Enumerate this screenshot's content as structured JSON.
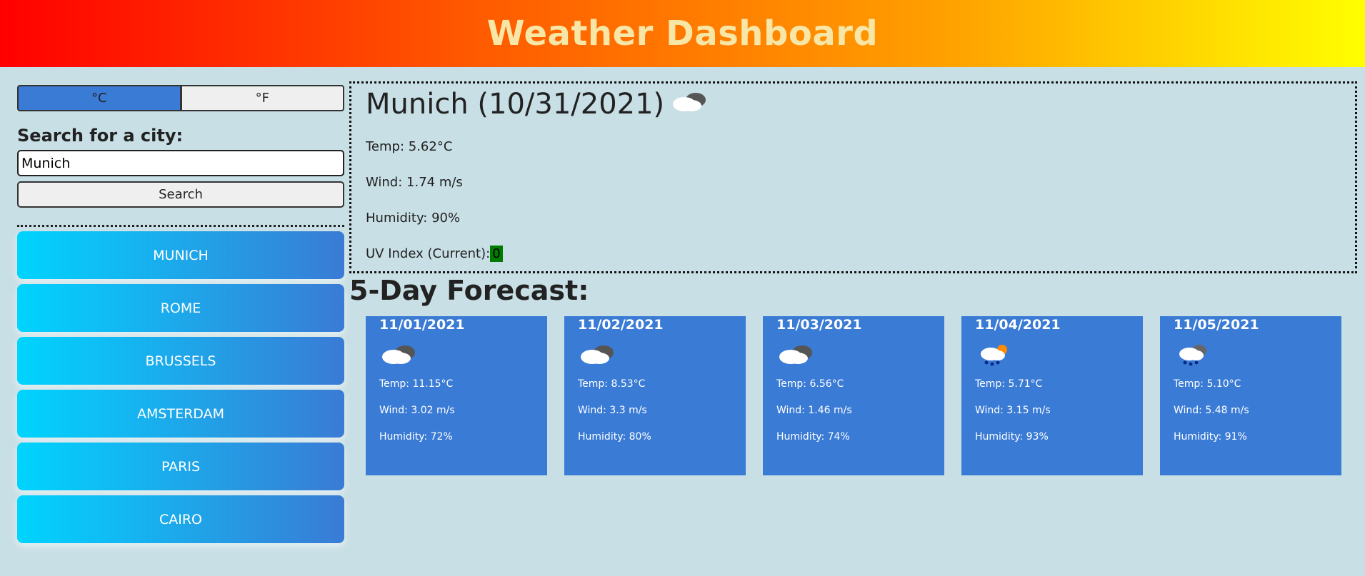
{
  "header": {
    "title": "Weather Dashboard"
  },
  "units": {
    "celsius_label": "°C",
    "fahrenheit_label": "°F",
    "active": "celsius"
  },
  "search": {
    "label": "Search for a city:",
    "value": "Munich",
    "button_label": "Search"
  },
  "history": [
    {
      "label": "MUNICH"
    },
    {
      "label": "ROME"
    },
    {
      "label": "BRUSSELS"
    },
    {
      "label": "AMSTERDAM"
    },
    {
      "label": "PARIS"
    },
    {
      "label": "CAIRO"
    }
  ],
  "current": {
    "heading": "Munich (10/31/2021)",
    "icon": "cloud-icon",
    "temp": "Temp: 5.62°C",
    "wind": "Wind: 1.74 m/s",
    "humidity": "Humidity: 90%",
    "uv_label": "UV Index (Current):",
    "uv_value": "0",
    "uv_color": "#007a00"
  },
  "forecast": {
    "title": "5-Day Forecast:",
    "days": [
      {
        "date": "11/01/2021",
        "icon": "cloud-icon",
        "temp": "Temp: 11.15°C",
        "wind": "Wind: 3.02 m/s",
        "humidity": "Humidity: 72%"
      },
      {
        "date": "11/02/2021",
        "icon": "cloud-icon",
        "temp": "Temp: 8.53°C",
        "wind": "Wind: 3.3 m/s",
        "humidity": "Humidity: 80%"
      },
      {
        "date": "11/03/2021",
        "icon": "cloud-icon",
        "temp": "Temp: 6.56°C",
        "wind": "Wind: 1.46 m/s",
        "humidity": "Humidity: 74%"
      },
      {
        "date": "11/04/2021",
        "icon": "sun-rain-icon",
        "temp": "Temp: 5.71°C",
        "wind": "Wind: 3.15 m/s",
        "humidity": "Humidity: 93%"
      },
      {
        "date": "11/05/2021",
        "icon": "rain-cloud-icon",
        "temp": "Temp: 5.10°C",
        "wind": "Wind: 5.48 m/s",
        "humidity": "Humidity: 91%"
      }
    ]
  },
  "colors": {
    "accent": "#3a7bd5",
    "gradient_start": "#00d4ff",
    "background": "#c8dfe5"
  }
}
